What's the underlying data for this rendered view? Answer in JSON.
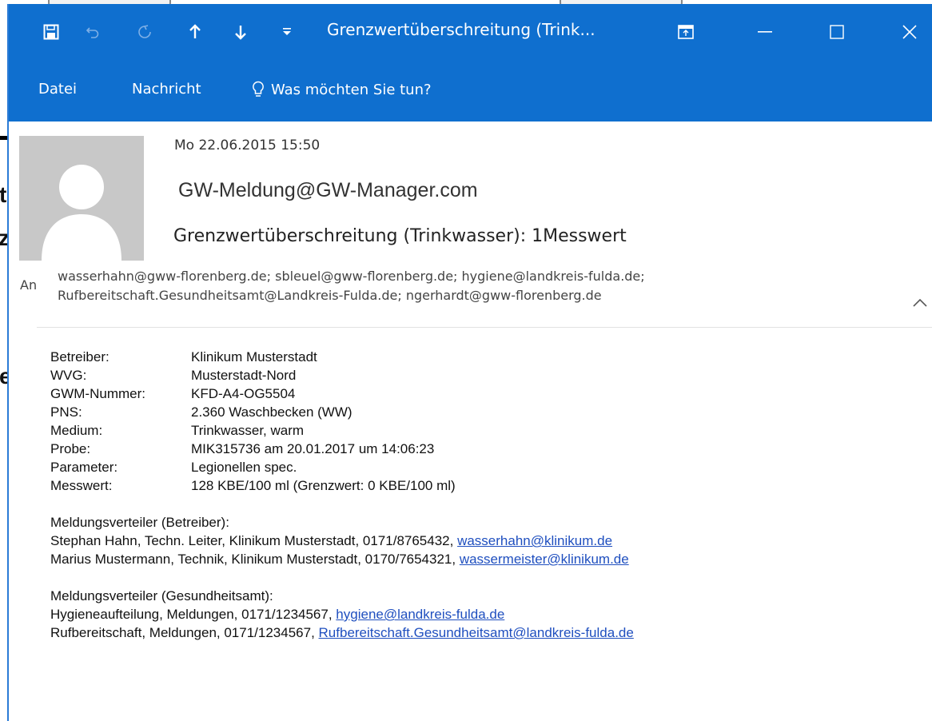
{
  "title_bar": {
    "title": "Grenzwertüberschreitung (Trink...",
    "icons": [
      "save-icon",
      "undo-icon",
      "redo-icon",
      "up-arrow-icon",
      "down-arrow-icon",
      "customize-icon",
      "ribbon-display-icon",
      "minimize-icon",
      "maximize-icon",
      "close-icon"
    ]
  },
  "ribbon": {
    "tabs": [
      "Datei",
      "Nachricht"
    ],
    "tell_me": "Was möchten Sie tun?"
  },
  "message": {
    "date": "Mo 22.06.2015 15:50",
    "sender": "GW-Meldung@GW-Manager.com",
    "subject": "Grenzwertüberschreitung (Trinkwasser): 1Messwert",
    "to_label": "An",
    "to_line1": "wasserhahn@gww-florenberg.de; sbleuel@gww-florenberg.de; hygiene@landkreis-fulda.de;",
    "to_line2": "Rufbereitschaft.Gesundheitsamt@Landkreis-Fulda.de; ngerhardt@gww-florenberg.de"
  },
  "body": {
    "fields": [
      {
        "key": "Betreiber:",
        "value": "Klinikum Musterstadt"
      },
      {
        "key": "WVG:",
        "value": "Musterstadt-Nord"
      },
      {
        "key": "GWM-Nummer:",
        "value": "KFD-A4-OG5504"
      },
      {
        "key": "PNS:",
        "value": "2.360 Waschbecken (WW)"
      },
      {
        "key": "Medium:",
        "value": "Trinkwasser, warm"
      },
      {
        "key": "Probe:",
        "value": "MIK315736 am 20.01.2017 um 14:06:23"
      },
      {
        "key": "Parameter:",
        "value": "Legionellen spec."
      },
      {
        "key": "Messwert:",
        "value": "128 KBE/100 ml (Grenzwert: 0 KBE/100 ml)"
      }
    ],
    "dist1_title": "Meldungsverteiler (Betreiber):",
    "dist1_line1_text": "Stephan Hahn, Techn. Leiter, Klinikum Musterstadt, 0171/8765432, ",
    "dist1_line1_link": "wasserhahn@klinikum.de",
    "dist1_line2_text": "Marius Mustermann, Technik, Klinikum Musterstadt, 0170/7654321, ",
    "dist1_line2_link": "wassermeister@klinikum.de",
    "dist2_title": "Meldungsverteiler (Gesundheitsamt):",
    "dist2_line1_text": "Hygieneaufteilung, Meldungen, 0171/1234567, ",
    "dist2_line1_link": "hygiene@landkreis-fulda.de",
    "dist2_line2_text": "Rufbereitschaft, Meldungen, 0171/1234567, ",
    "dist2_line2_link": "Rufbereitschaft.Gesundheitsamt@landkreis-fulda.de"
  },
  "background_fragments": [
    "t",
    "z",
    "e"
  ]
}
